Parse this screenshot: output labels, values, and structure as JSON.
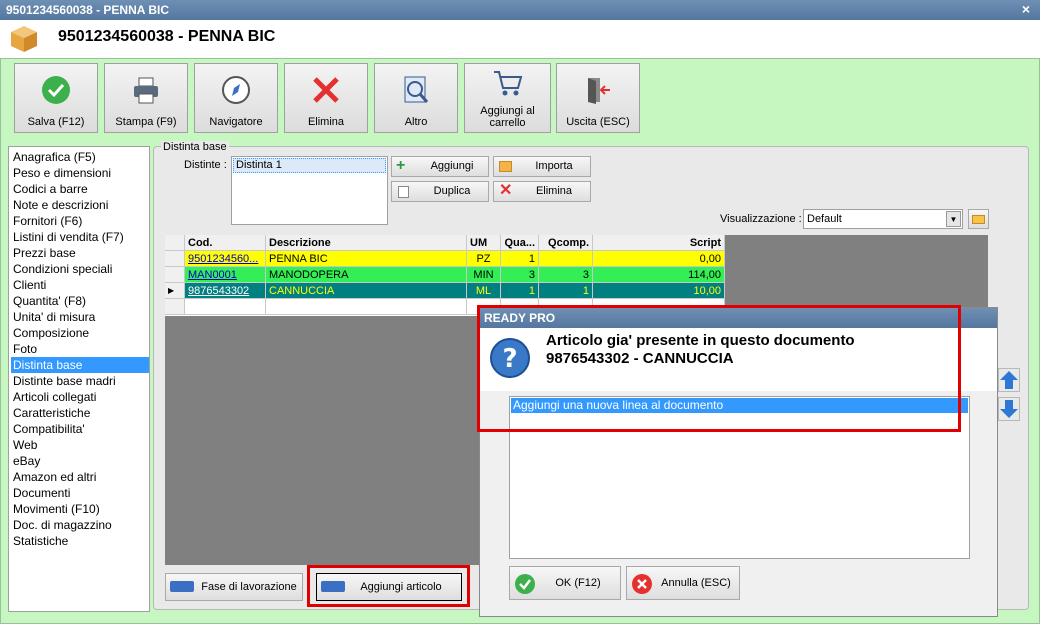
{
  "window": {
    "title": "9501234560038 - PENNA BIC",
    "close": "×"
  },
  "header": {
    "title": "9501234560038 - PENNA BIC"
  },
  "toolbar": {
    "save": "Salva (F12)",
    "print": "Stampa (F9)",
    "navigator": "Navigatore",
    "delete": "Elimina",
    "other": "Altro",
    "cart_line1": "Aggiungi al",
    "cart_line2": "carrello",
    "exit": "Uscita (ESC)"
  },
  "sidebar": {
    "items": [
      "Anagrafica (F5)",
      "Peso e dimensioni",
      "Codici a barre",
      "Note e descrizioni",
      "Fornitori (F6)",
      "Listini di vendita (F7)",
      "Prezzi base",
      "Condizioni speciali",
      "Clienti",
      "Quantita' (F8)",
      "Unita' di misura",
      "Composizione",
      "Foto",
      "Distinta base",
      "Distinte base madri",
      "Articoli collegati",
      "Caratteristiche",
      "Compatibilita'",
      "Web",
      "eBay",
      "Amazon ed altri",
      "Documenti",
      "Movimenti (F10)",
      "Doc. di magazzino",
      "Statistiche"
    ],
    "selected_index": 13
  },
  "panel": {
    "group_title": "Distinta base",
    "distinte_label": "Distinte :",
    "distinte_items": [
      "Distinta 1"
    ],
    "add": "Aggiungi",
    "import": "Importa",
    "duplicate": "Duplica",
    "delete": "Elimina",
    "view_label": "Visualizzazione :",
    "view_value": "Default"
  },
  "grid": {
    "columns": [
      "Cod.",
      "Descrizione",
      "UM",
      "Qua...",
      "Qcomp.",
      "Script"
    ],
    "rows": [
      {
        "cod": "9501234560...",
        "desc": "PENNA BIC",
        "um": "PZ",
        "qua": "1",
        "qcomp": "",
        "script": "0,00",
        "bg": "#ffff00",
        "fg": "#000000"
      },
      {
        "cod": "MAN0001",
        "desc": "MANODOPERA",
        "um": "MIN",
        "qua": "3",
        "qcomp": "3",
        "script": "114,00",
        "bg": "#33ee55",
        "fg": "#000000"
      },
      {
        "cod": "9876543302",
        "desc": "CANNUCCIA",
        "um": "ML",
        "qua": "1",
        "qcomp": "1",
        "script": "10,00",
        "bg": "#008080",
        "fg": "#ffff00"
      }
    ]
  },
  "bottom": {
    "phase": "Fase di lavorazione",
    "add_article": "Aggiungi articolo"
  },
  "dialog": {
    "title": "READY PRO",
    "message1": "Articolo gia' presente in questo documento",
    "message2": "9876543302 - CANNUCCIA",
    "options": [
      "Aggiungi una nuova linea al documento"
    ],
    "ok": "OK (F12)",
    "cancel": "Annulla (ESC)"
  }
}
